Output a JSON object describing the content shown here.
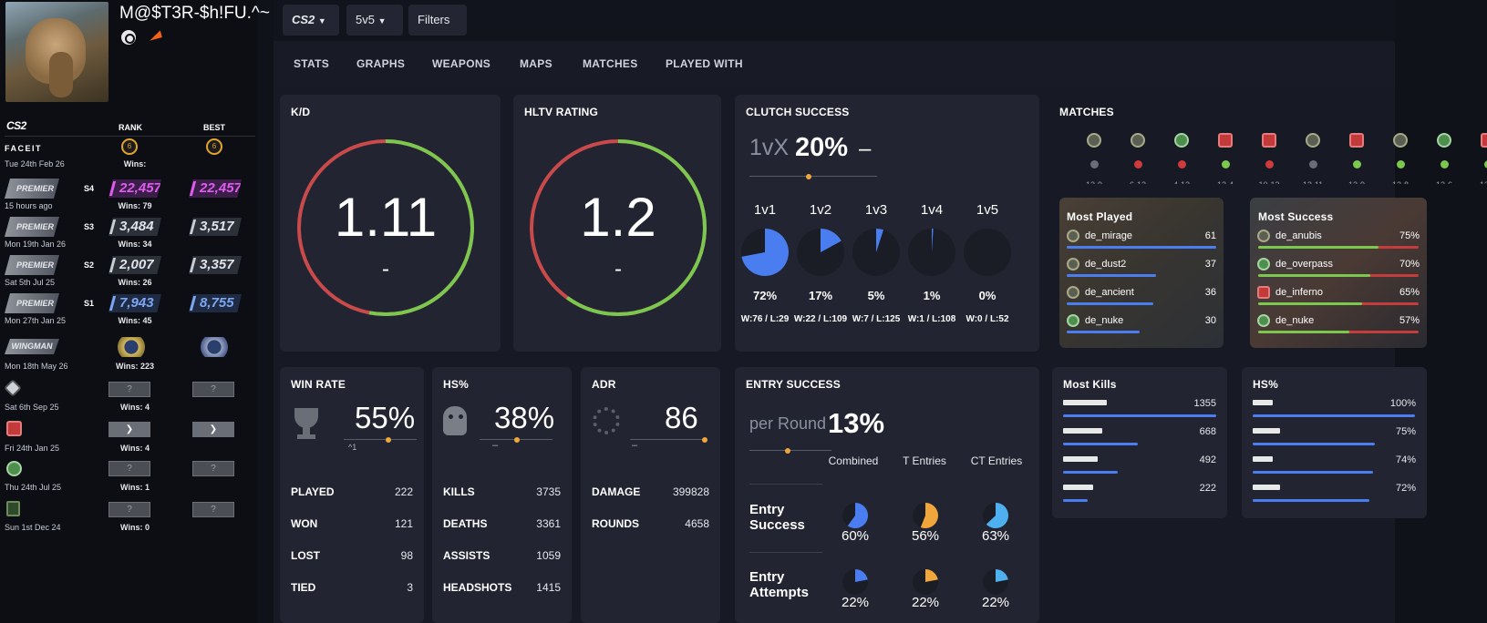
{
  "player": {
    "name": "M@$T3R-$h!FU.^~"
  },
  "sidebar": {
    "game_logo": "CS2",
    "col_rank": "RANK",
    "col_best": "BEST",
    "faceit": {
      "logo": "FACEIT",
      "date": "Tue 24th Feb 26",
      "wins": "Wins:",
      "rank_level": "6",
      "best_level": "6"
    },
    "premier": [
      {
        "label": "PREMIER",
        "season": "S4",
        "date": "15 hours ago",
        "rank": "22,457",
        "best": "22,457",
        "wins": "Wins: 79",
        "color": "purple"
      },
      {
        "label": "PREMIER",
        "season": "S3",
        "date": "Mon 19th Jan 26",
        "rank": "3,484",
        "best": "3,517",
        "wins": "Wins: 34",
        "color": "grey"
      },
      {
        "label": "PREMIER",
        "season": "S2",
        "date": "Sat 5th Jul 25",
        "rank": "2,007",
        "best": "3,357",
        "wins": "Wins: 26",
        "color": "grey"
      },
      {
        "label": "PREMIER",
        "season": "S1",
        "date": "Mon 27th Jan 25",
        "rank": "7,943",
        "best": "8,755",
        "wins": "Wins: 45",
        "color": "blue"
      }
    ],
    "wingman": {
      "label": "WINGMAN",
      "date": "Mon 18th May 26",
      "wins": "Wins: 223"
    },
    "map_ranks": [
      {
        "date": "Sat 6th Sep 25",
        "wins": "Wins: 4",
        "rank": "?",
        "best": "?"
      },
      {
        "date": "Fri 24th Jan 25",
        "wins": "Wins: 4",
        "rank": "",
        "best": ""
      },
      {
        "date": "Thu 24th Jul 25",
        "wins": "Wins: 1",
        "rank": "?",
        "best": "?"
      },
      {
        "date": "Sun 1st Dec 24",
        "wins": "Wins: 0",
        "rank": "?",
        "best": "?"
      }
    ]
  },
  "toolbar": {
    "game": "CS2",
    "mode": "5v5",
    "filters": "Filters"
  },
  "tabs": [
    "STATS",
    "GRAPHS",
    "WEAPONS",
    "MAPS",
    "MATCHES",
    "PLAYED WITH"
  ],
  "kd": {
    "title": "K/D",
    "value": "1.11",
    "sub": "-",
    "ratio": 0.53
  },
  "hltv": {
    "title": "HLTV RATING",
    "value": "1.2",
    "sub": "-",
    "ratio": 0.6
  },
  "clutch": {
    "title": "CLUTCH SUCCESS",
    "prefix": "1vX",
    "value": "20%",
    "suffix": "–",
    "items": [
      {
        "label": "1v1",
        "pct": "72%",
        "ratio": 0.72,
        "wl": "W:76 / L:29"
      },
      {
        "label": "1v2",
        "pct": "17%",
        "ratio": 0.17,
        "wl": "W:22 / L:109"
      },
      {
        "label": "1v3",
        "pct": "5%",
        "ratio": 0.05,
        "wl": "W:7 / L:125"
      },
      {
        "label": "1v4",
        "pct": "1%",
        "ratio": 0.01,
        "wl": "W:1 / L:108"
      },
      {
        "label": "1v5",
        "pct": "0%",
        "ratio": 0.0,
        "wl": "W:0 / L:52"
      }
    ]
  },
  "matches": {
    "title": "MATCHES",
    "results": [
      "draw",
      "loss",
      "loss",
      "win",
      "loss",
      "draw",
      "win",
      "win",
      "win",
      "win"
    ],
    "maps": [
      "de_ancient",
      "de_ancient",
      "de_nuke",
      "de_inferno",
      "de_inferno",
      "de_ancient",
      "de_inferno",
      "de_anubis",
      "de_overpass",
      "de_inferno"
    ],
    "scores": [
      "13-9",
      "6-13",
      "4-13",
      "13-4",
      "10-13",
      "13-11",
      "13-9",
      "13-8",
      "13-6",
      "13-5"
    ]
  },
  "most_played": {
    "title": "Most Played",
    "rows": [
      {
        "map": "de_mirage",
        "value": "61",
        "ratio": 1.0
      },
      {
        "map": "de_dust2",
        "value": "37",
        "ratio": 0.6
      },
      {
        "map": "de_ancient",
        "value": "36",
        "ratio": 0.58
      },
      {
        "map": "de_nuke",
        "value": "30",
        "ratio": 0.49
      }
    ]
  },
  "most_success": {
    "title": "Most Success",
    "rows": [
      {
        "map": "de_anubis",
        "value": "75%",
        "ratio": 0.75
      },
      {
        "map": "de_overpass",
        "value": "70%",
        "ratio": 0.7
      },
      {
        "map": "de_inferno",
        "value": "65%",
        "ratio": 0.65
      },
      {
        "map": "de_nuke",
        "value": "57%",
        "ratio": 0.57
      }
    ]
  },
  "winrate": {
    "title": "WIN RATE",
    "value": "55%",
    "delta": "1",
    "rows": [
      {
        "k": "PLAYED",
        "v": "222"
      },
      {
        "k": "WON",
        "v": "121"
      },
      {
        "k": "LOST",
        "v": "98"
      },
      {
        "k": "TIED",
        "v": "3"
      }
    ]
  },
  "hs": {
    "title": "HS%",
    "value": "38%",
    "sub": "–",
    "rows": [
      {
        "k": "KILLS",
        "v": "3735"
      },
      {
        "k": "DEATHS",
        "v": "3361"
      },
      {
        "k": "ASSISTS",
        "v": "1059"
      },
      {
        "k": "HEADSHOTS",
        "v": "1415"
      }
    ]
  },
  "adr": {
    "title": "ADR",
    "value": "86",
    "sub": "–",
    "rows": [
      {
        "k": "DAMAGE",
        "v": "399828"
      },
      {
        "k": "ROUNDS",
        "v": "4658"
      }
    ]
  },
  "entry": {
    "title": "ENTRY SUCCESS",
    "prefix": "per Round",
    "value": "13%",
    "cols": [
      "Combined",
      "T Entries",
      "CT Entries"
    ],
    "success_label": "Entry Success",
    "attempts_label": "Entry Attempts",
    "success": [
      {
        "pct": "60%",
        "ratio": 0.6,
        "color": "#4a7ef0"
      },
      {
        "pct": "56%",
        "ratio": 0.56,
        "color": "#f0a63a"
      },
      {
        "pct": "63%",
        "ratio": 0.63,
        "color": "#4fb0f0"
      }
    ],
    "attempts": [
      {
        "pct": "22%",
        "ratio": 0.22,
        "color": "#4a7ef0"
      },
      {
        "pct": "22%",
        "ratio": 0.22,
        "color": "#f0a63a"
      },
      {
        "pct": "22%",
        "ratio": 0.22,
        "color": "#4fb0f0"
      }
    ]
  },
  "most_kills": {
    "title": "Most Kills",
    "rows": [
      {
        "v": "1355",
        "ratio": 1.0
      },
      {
        "v": "668",
        "ratio": 0.49
      },
      {
        "v": "492",
        "ratio": 0.36
      },
      {
        "v": "222",
        "ratio": 0.16
      }
    ]
  },
  "hs_weapons": {
    "title": "HS%",
    "rows": [
      {
        "v": "100%",
        "ratio": 1.0
      },
      {
        "v": "75%",
        "ratio": 0.75
      },
      {
        "v": "74%",
        "ratio": 0.74
      },
      {
        "v": "72%",
        "ratio": 0.72
      }
    ]
  },
  "colors": {
    "green": "#7cc84f",
    "red": "#c94a4a",
    "blue": "#4a7ef0",
    "orange": "#f0a63a"
  }
}
